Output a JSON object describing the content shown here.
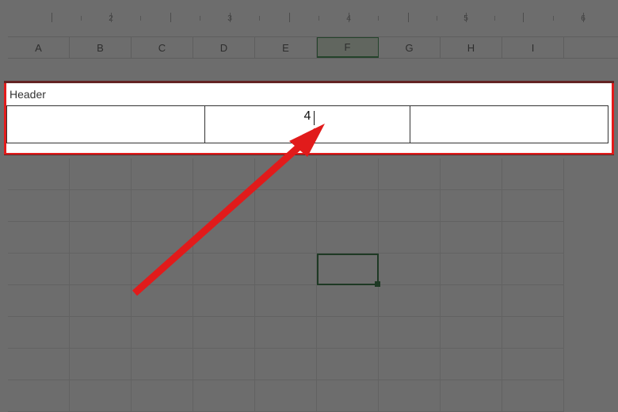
{
  "ruler": {
    "numbers": [
      "2",
      "3",
      "4",
      "5",
      "6"
    ]
  },
  "columns": {
    "labels": [
      "A",
      "B",
      "C",
      "D",
      "E",
      "F",
      "G",
      "H",
      "I"
    ],
    "selected": "F"
  },
  "header_editor": {
    "label": "Header",
    "center_value": "4"
  },
  "colors": {
    "highlight_outline": "#e11b1b",
    "cell_select": "#0b5d1e"
  },
  "grid": {
    "selected_cell": {
      "row": 4,
      "col": 5
    }
  }
}
